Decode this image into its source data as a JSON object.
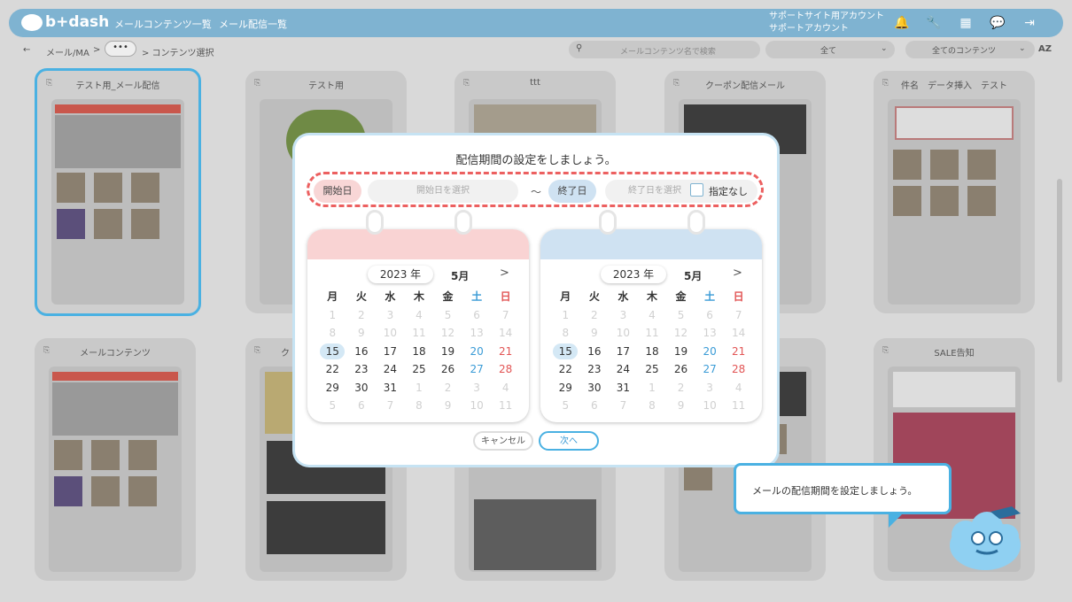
{
  "header": {
    "logo": "b+dash",
    "nav": [
      "メールコンテンツ一覧",
      "メール配信一覧"
    ],
    "account_line1": "サポートサイト用アカウント",
    "account_line2": "サポートアカウント"
  },
  "subbar": {
    "back": "←",
    "crumb1": "メール/MA",
    "sep": ">",
    "more": "•••",
    "crumb2": "> コンテンツ選択",
    "search_placeholder": "メールコンテンツ名で検索",
    "filter1": "全て",
    "filter2": "全てのコンテンツ",
    "sort": "AZ"
  },
  "cards": [
    {
      "title": "テスト用_メール配信"
    },
    {
      "title": "テスト用"
    },
    {
      "title": "ttt"
    },
    {
      "title": "クーポン配信メール"
    },
    {
      "title": "件名　データ挿入　テスト"
    },
    {
      "title": "メールコンテンツ"
    },
    {
      "title": "ク"
    },
    {
      "title": ""
    },
    {
      "title": ""
    },
    {
      "title": "SALE告知"
    }
  ],
  "modal": {
    "title": "配信期間の設定をしましょう。",
    "start_label": "開始日",
    "start_placeholder": "開始日を選択",
    "tilde": "～",
    "end_label": "終了日",
    "end_placeholder": "終了日を選択",
    "no_end": "指定なし",
    "cancel": "キャンセル",
    "next": "次へ"
  },
  "calendars": [
    {
      "year": "2023 年",
      "month": "5月",
      "next": ">",
      "band_color": "#f9d3d3"
    },
    {
      "year": "2023 年",
      "month": "5月",
      "next": ">",
      "band_color": "#cfe2f2"
    }
  ],
  "weekdays": [
    "月",
    "火",
    "水",
    "木",
    "金",
    "土",
    "日"
  ],
  "weeks": [
    [
      [
        "1",
        0
      ],
      [
        "2",
        0
      ],
      [
        "3",
        0
      ],
      [
        "4",
        0
      ],
      [
        "5",
        0
      ],
      [
        "6",
        0
      ],
      [
        "7",
        0
      ]
    ],
    [
      [
        "8",
        0
      ],
      [
        "9",
        0
      ],
      [
        "10",
        0
      ],
      [
        "11",
        0
      ],
      [
        "12",
        0
      ],
      [
        "13",
        0
      ],
      [
        "14",
        0
      ]
    ],
    [
      [
        "15",
        1
      ],
      [
        "16",
        1
      ],
      [
        "17",
        1
      ],
      [
        "18",
        1
      ],
      [
        "19",
        1
      ],
      [
        "20",
        1
      ],
      [
        "21",
        1
      ]
    ],
    [
      [
        "22",
        1
      ],
      [
        "23",
        1
      ],
      [
        "24",
        1
      ],
      [
        "25",
        1
      ],
      [
        "26",
        1
      ],
      [
        "27",
        1
      ],
      [
        "28",
        1
      ]
    ],
    [
      [
        "29",
        1
      ],
      [
        "30",
        1
      ],
      [
        "31",
        1
      ],
      [
        "1",
        0
      ],
      [
        "2",
        0
      ],
      [
        "3",
        0
      ],
      [
        "4",
        0
      ]
    ],
    [
      [
        "5",
        0
      ],
      [
        "6",
        0
      ],
      [
        "7",
        0
      ],
      [
        "8",
        0
      ],
      [
        "9",
        0
      ],
      [
        "10",
        0
      ],
      [
        "11",
        0
      ]
    ]
  ],
  "today": "15",
  "tooltip": "メールの配信期間を設定しましょう。"
}
